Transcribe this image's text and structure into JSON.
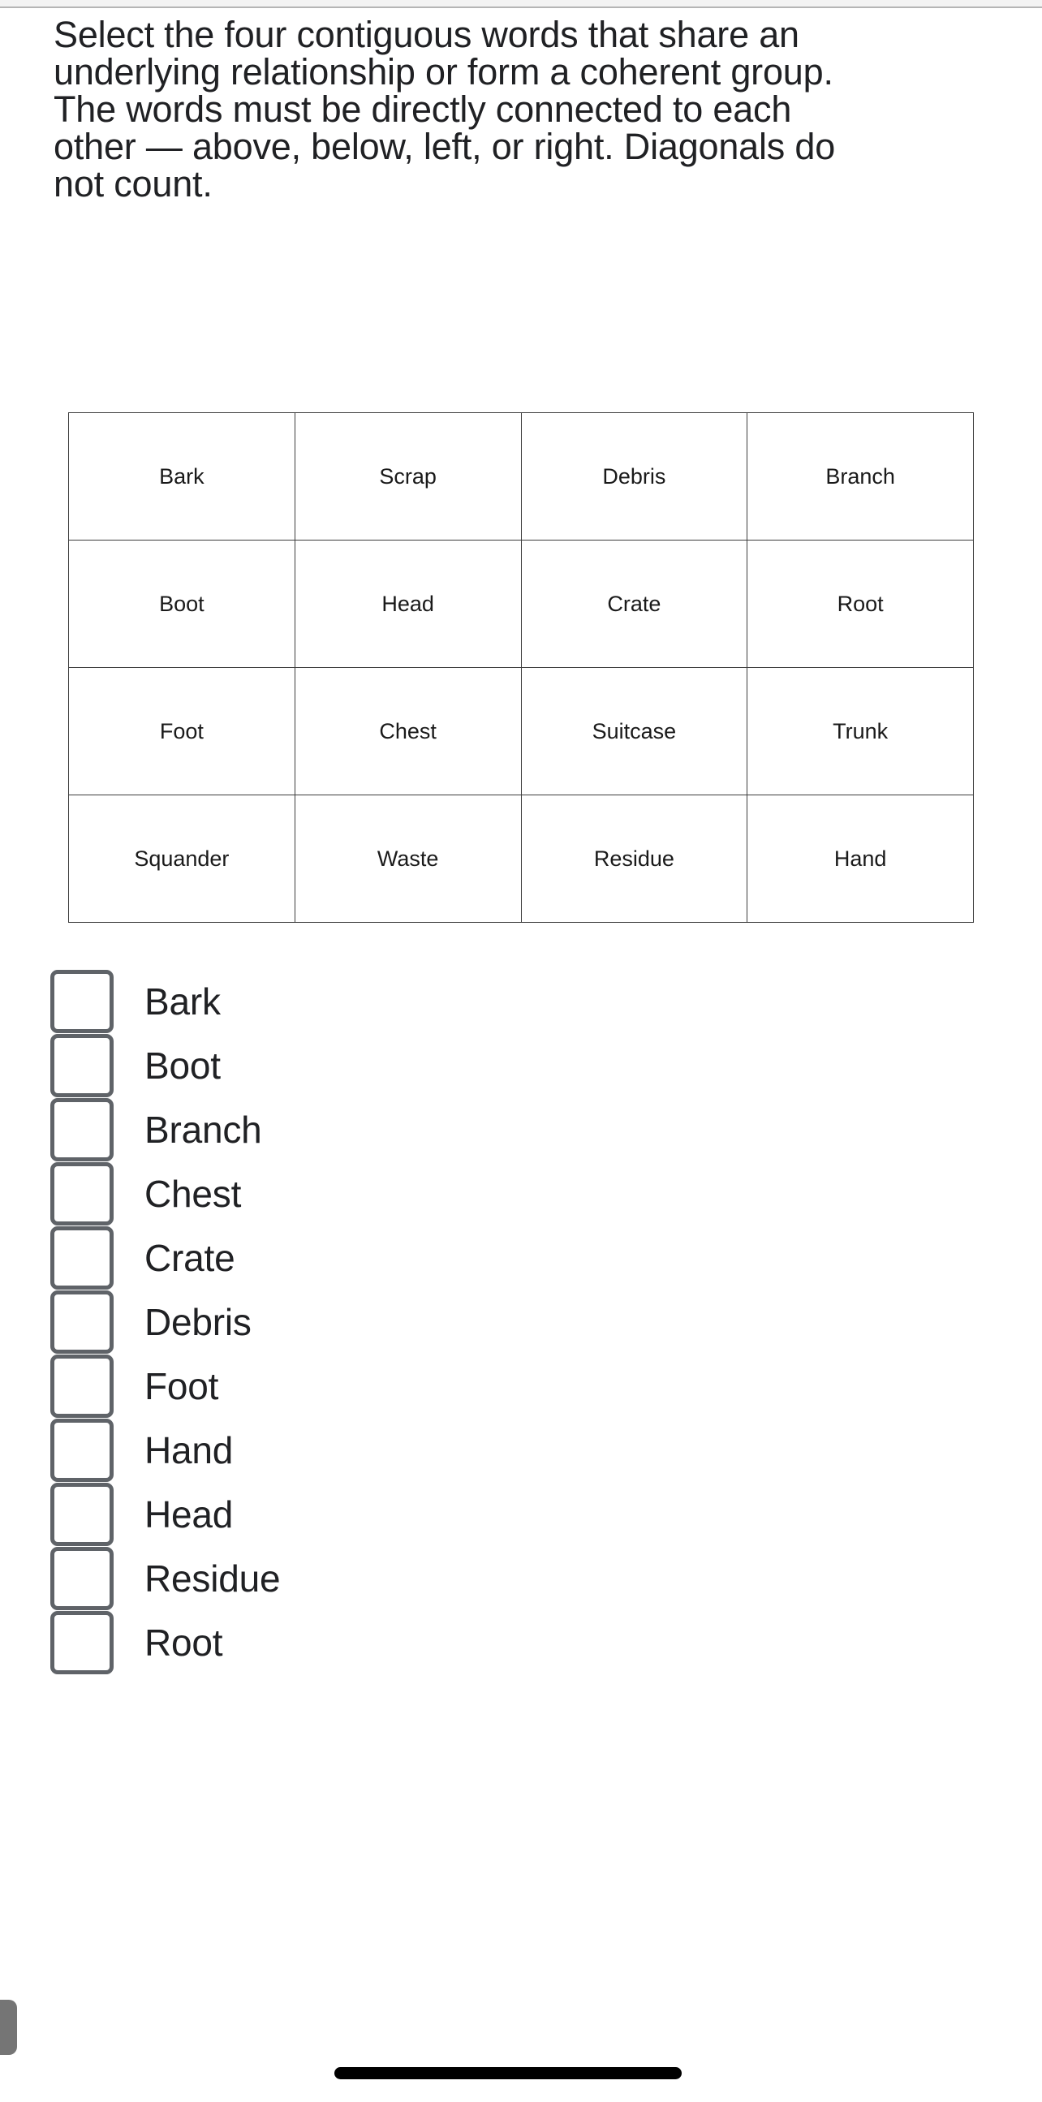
{
  "instructions": {
    "lines": [
      "Select the four contiguous words that share an",
      "underlying relationship or form a coherent group.",
      "The words must be directly connected to each",
      "other — above, below, left, or right. Diagonals do",
      "not count."
    ],
    "full_text": "Select the four contiguous words that share an underlying relationship or form a coherent group. The words must be directly connected to each other — above, below, left, or right. Diagonals do not count."
  },
  "grid": {
    "rows": [
      [
        "Bark",
        "Scrap",
        "Debris",
        "Branch"
      ],
      [
        "Boot",
        "Head",
        "Crate",
        "Root"
      ],
      [
        "Foot",
        "Chest",
        "Suitcase",
        "Trunk"
      ],
      [
        "Squander",
        "Waste",
        "Residue",
        "Hand"
      ]
    ]
  },
  "options": [
    {
      "label": "Bark",
      "checked": false
    },
    {
      "label": "Boot",
      "checked": false
    },
    {
      "label": "Branch",
      "checked": false
    },
    {
      "label": "Chest",
      "checked": false
    },
    {
      "label": "Crate",
      "checked": false
    },
    {
      "label": "Debris",
      "checked": false
    },
    {
      "label": "Foot",
      "checked": false
    },
    {
      "label": "Hand",
      "checked": false
    },
    {
      "label": "Head",
      "checked": false
    },
    {
      "label": "Residue",
      "checked": false
    },
    {
      "label": "Root",
      "checked": false
    }
  ],
  "colors": {
    "text": "#202124",
    "grid_border": "#3c3c3c",
    "checkbox_border": "#5f6368",
    "scrollbar_thumb": "#757575",
    "home_indicator": "#000000",
    "chrome_strip": "#f3f3f3"
  }
}
